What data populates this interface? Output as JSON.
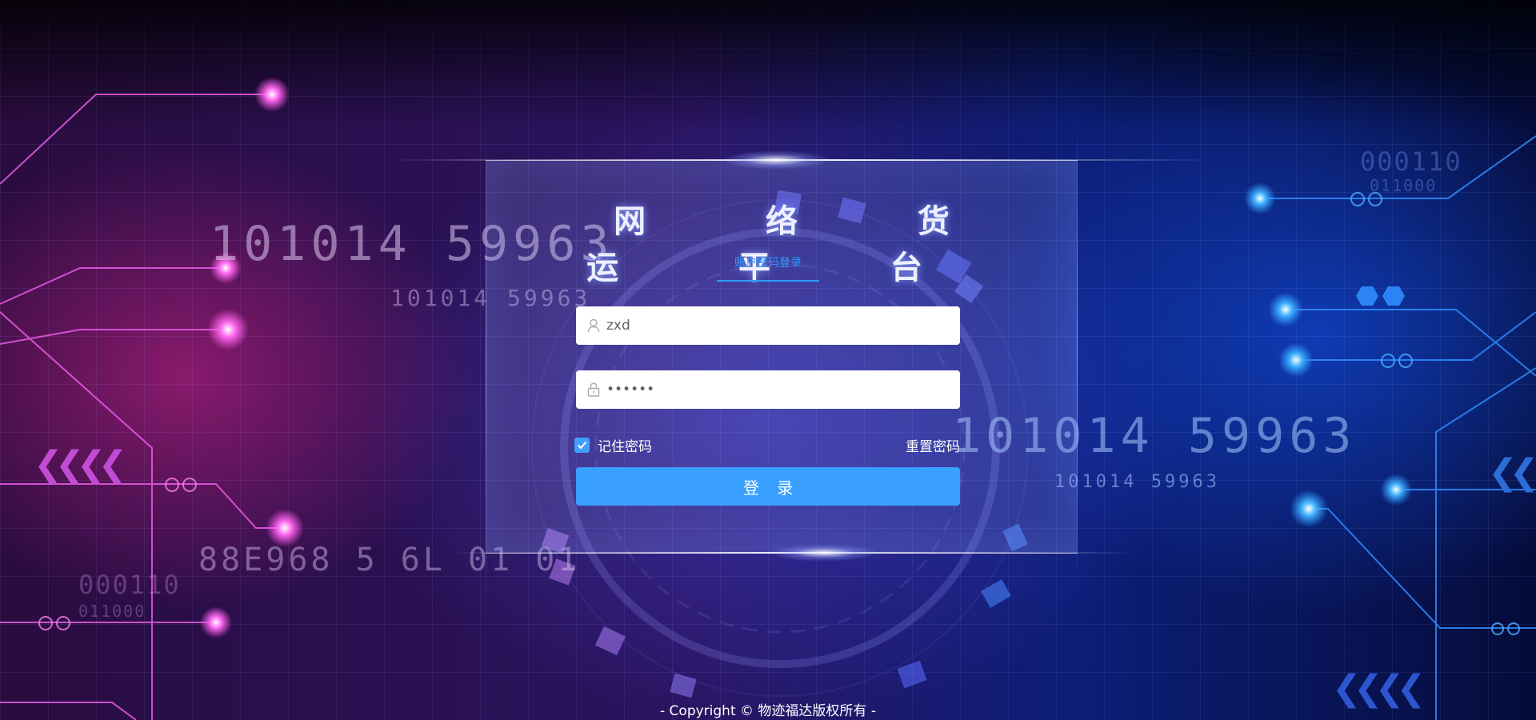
{
  "title": "网 络 货 运 平 台",
  "tab": {
    "label": "账户密码登录"
  },
  "username": {
    "value": "zxd",
    "icon": "user-icon"
  },
  "password": {
    "value": "••••••",
    "icon": "lock-icon"
  },
  "remember": {
    "label": "记住密码",
    "checked": true
  },
  "reset_password": {
    "label": "重置密码"
  },
  "login_button": {
    "label": "登 录"
  },
  "copyright": "- Copyright © 物迹福达版权所有 -",
  "decor": {
    "left_big_digits": "101014 59963",
    "left_small_digits": "101014 59963",
    "left_bottom_digits": "88E968 5 6L 01 01",
    "left_code": "000110",
    "left_code_sub": "011000",
    "right_big_digits": "101014 59963",
    "right_small_digits": "101014 59963",
    "right_code": "000110",
    "right_code_sub": "011000"
  },
  "colors": {
    "accent": "#409eff",
    "button": "#3aa0ff",
    "tab": "#2f9bff",
    "magenta_glow": "#ff5cf0",
    "blue_glow": "#3aa8ff"
  }
}
